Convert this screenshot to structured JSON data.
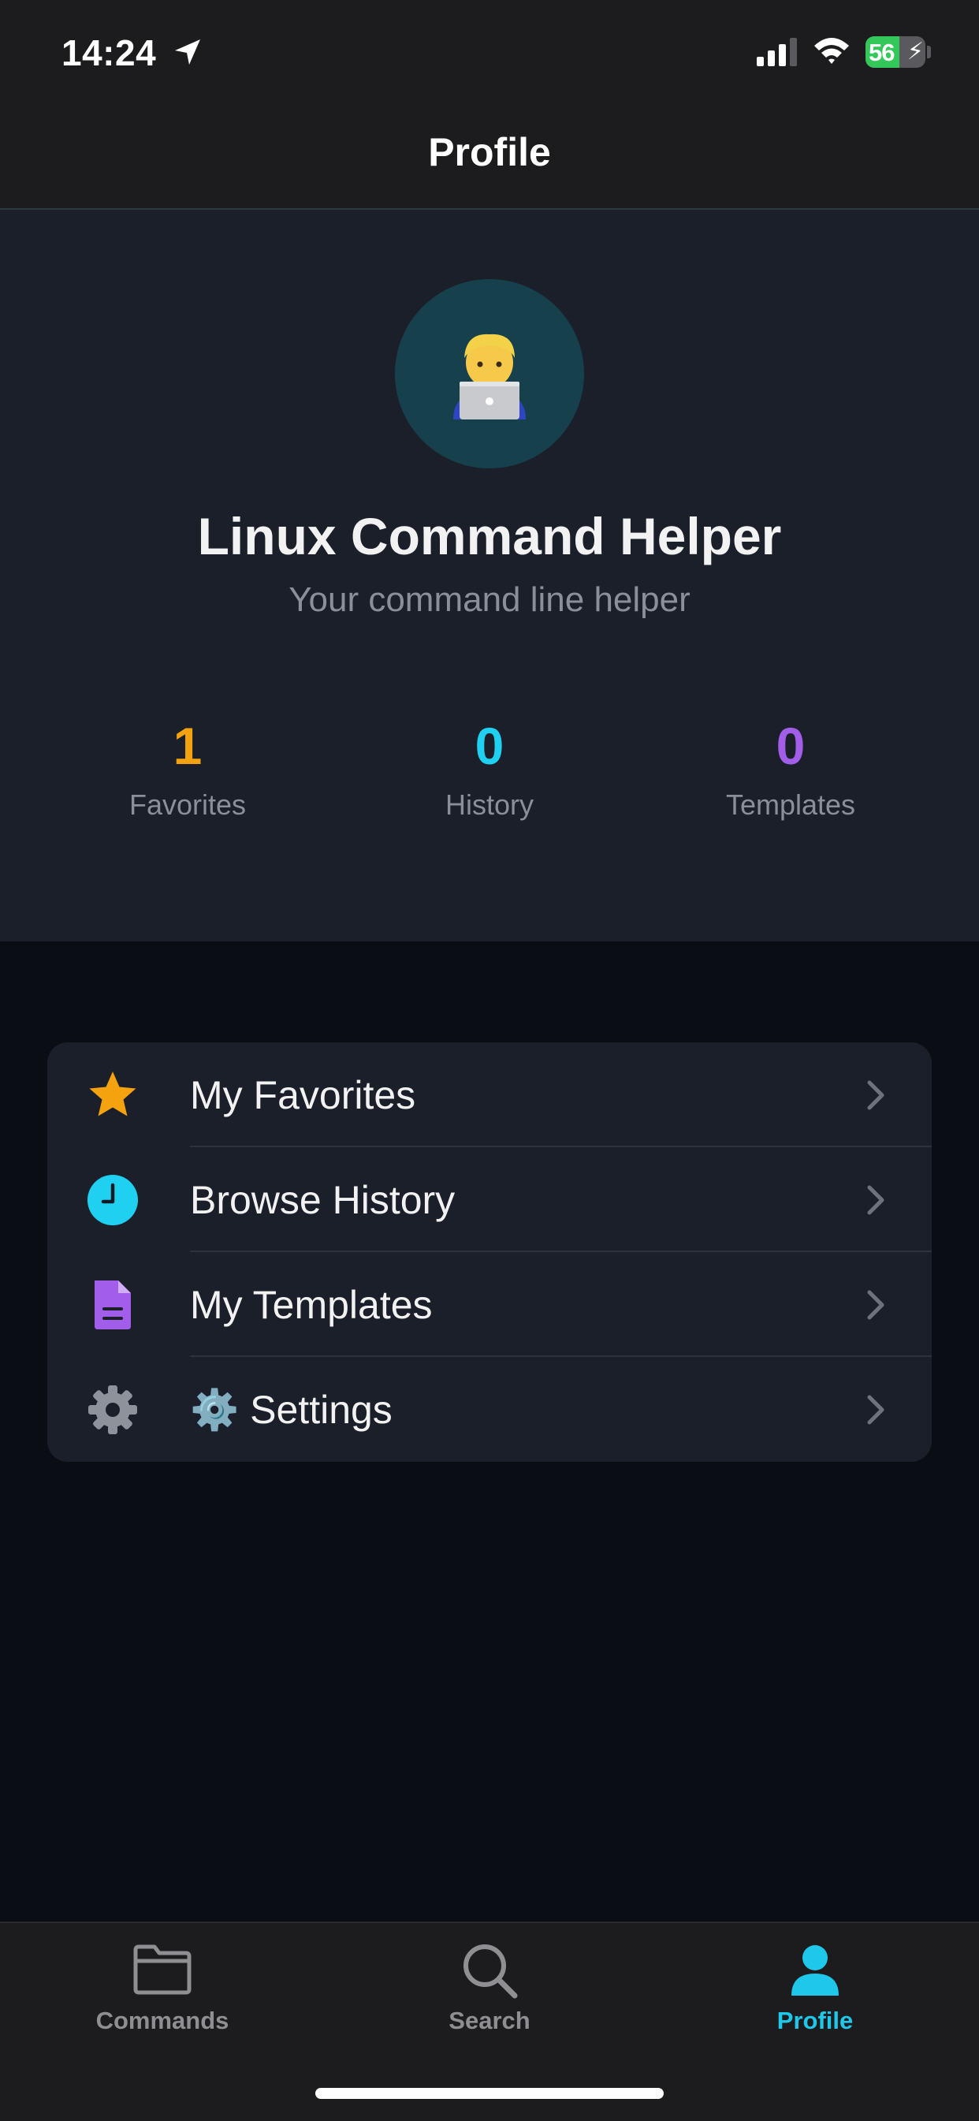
{
  "status_bar": {
    "time": "14:24",
    "battery_level": "56",
    "battery_percent": 56,
    "charging": true
  },
  "header": {
    "title": "Profile"
  },
  "profile": {
    "avatar_emoji": "man-technologist",
    "name": "Linux Command Helper",
    "subtitle": "Your command line helper"
  },
  "stats": [
    {
      "value": "1",
      "label": "Favorites",
      "color": "#f5a20f"
    },
    {
      "value": "0",
      "label": "History",
      "color": "#1fd0f0"
    },
    {
      "value": "0",
      "label": "Templates",
      "color": "#a25ee8"
    }
  ],
  "menu": {
    "items": [
      {
        "label": "My Favorites",
        "icon": "star-icon",
        "color": "#f5a20f"
      },
      {
        "label": "Browse History",
        "icon": "clock-icon",
        "color": "#1fd0f0"
      },
      {
        "label": "My Templates",
        "icon": "document-icon",
        "color": "#a25ee8"
      },
      {
        "label": "⚙️ Settings",
        "icon": "gear-icon",
        "color": "#8e929a"
      }
    ]
  },
  "tab_bar": {
    "tabs": [
      {
        "label": "Commands",
        "icon": "folder-icon",
        "active": false
      },
      {
        "label": "Search",
        "icon": "search-icon",
        "active": false
      },
      {
        "label": "Profile",
        "icon": "person-icon",
        "active": true
      }
    ],
    "active_color": "#1fc8eb",
    "inactive_color": "#8e8e93"
  }
}
